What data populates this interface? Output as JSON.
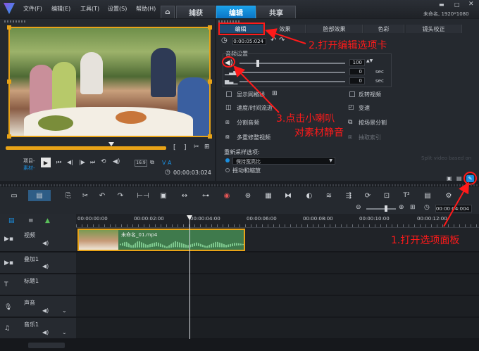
{
  "menu": [
    "文件(F)",
    "编辑(E)",
    "工具(T)",
    "设置(S)",
    "帮助(H)"
  ],
  "tabs": {
    "home": "⌂",
    "capture": "捕获",
    "edit": "编辑",
    "share": "共享"
  },
  "project_info": "未命名, 1920*1080",
  "player": {
    "project_label": "项目-",
    "clip_label": "素材-",
    "ratio": "16:9",
    "timecode": "00:00:03:024",
    "va": "V A"
  },
  "options_tabs": [
    "编辑",
    "效果",
    "脸部效果",
    "色彩",
    "镜头校正"
  ],
  "options": {
    "duration": "0:00:05:024",
    "audio_section": "音频设置",
    "volume": "100",
    "fadein": "0",
    "fadeout": "0",
    "sec": "sec",
    "left_items": [
      "显示网格线",
      "速度/时间流逝",
      "分割音频",
      "多重修整视频"
    ],
    "right_items": [
      "反转视频",
      "变速",
      "按场景分割",
      "抽取索引"
    ],
    "resample_label": "重新采样选项:",
    "resample_value": "保持宽高比",
    "pan_zoom": "摇动和缩放",
    "faded_text": "Split video based on"
  },
  "annotations": {
    "a1": "1.打开选项面板",
    "a2": "2.打开编辑选项卡",
    "a3_line1": "3.点击小喇叭",
    "a3_line2": "对素材静音"
  },
  "timeline": {
    "timecode": "00:00:04:004",
    "ruler": [
      "00:00:00:00",
      "00:00:02:00",
      "00:00:04:00",
      "00:00:06:00",
      "00:00:08:00",
      "00:00:10:00",
      "00:00:12:00"
    ],
    "tracks": [
      "视频",
      "叠加1",
      "标题1",
      "声音",
      "音乐1"
    ],
    "clip_name": "未命名_01.mp4"
  },
  "colors": {
    "accent": "#1a8fe0",
    "clip_green": "#3f7a4c",
    "clip_border": "#e8a317",
    "annotation": "#ff1a1a"
  }
}
